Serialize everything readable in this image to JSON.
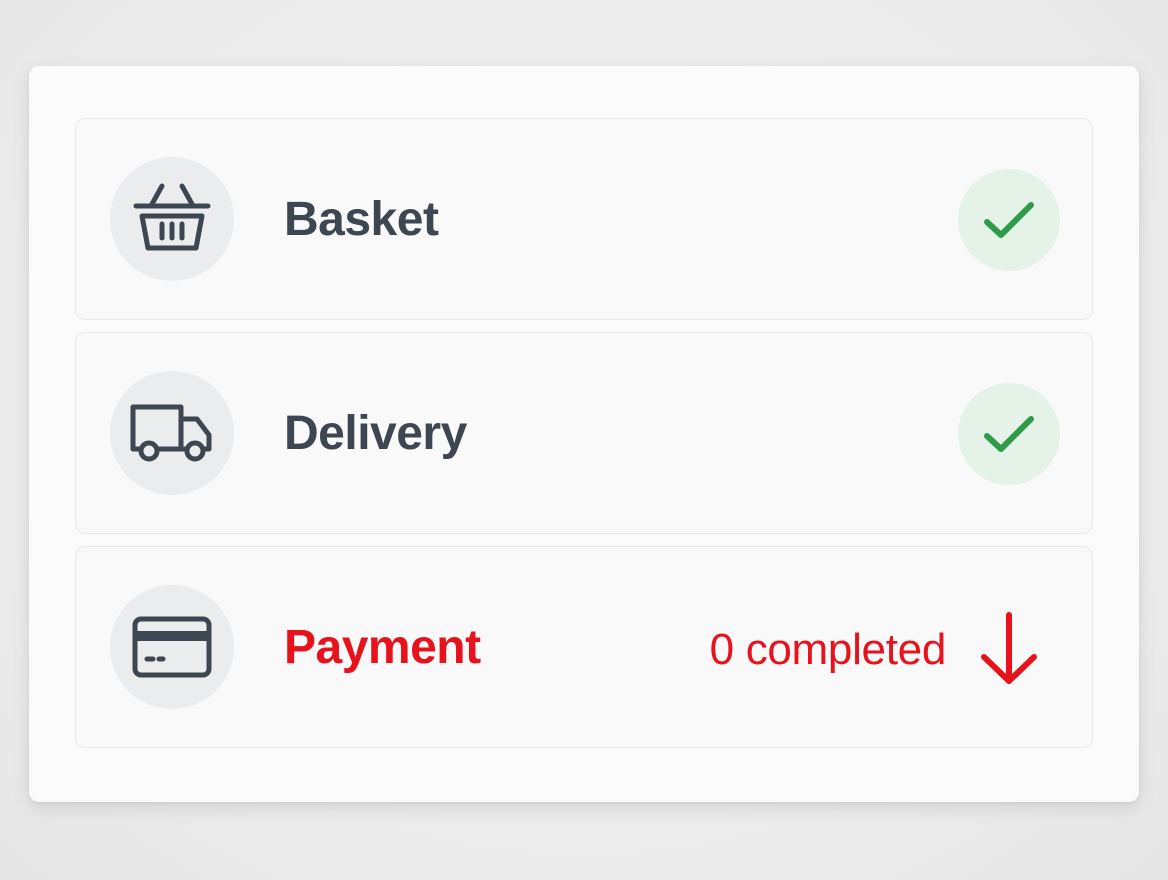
{
  "steps": [
    {
      "label": "Basket",
      "icon": "basket-icon",
      "status": "completed"
    },
    {
      "label": "Delivery",
      "icon": "truck-icon",
      "status": "completed"
    },
    {
      "label": "Payment",
      "icon": "credit-card-icon",
      "status": "pending",
      "status_text": "0 completed"
    }
  ],
  "colors": {
    "text": "#3d4651",
    "active": "#e8121c",
    "success": "#2e9a4a",
    "success_bg": "#e4f2e7",
    "icon_bg": "#ebecee"
  }
}
